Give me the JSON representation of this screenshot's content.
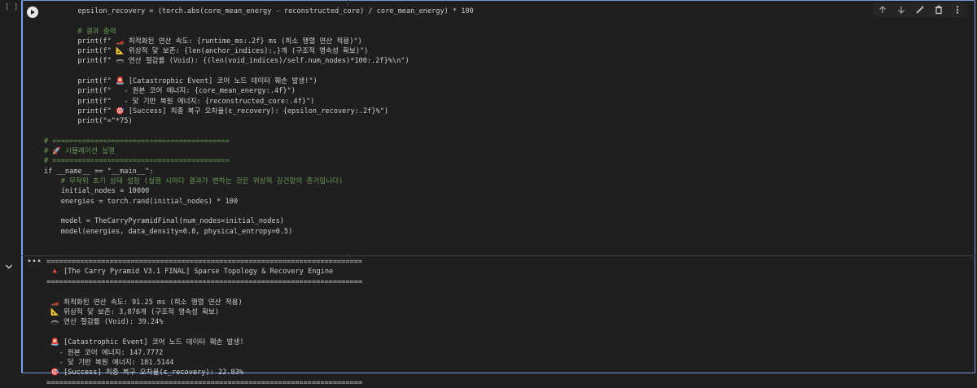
{
  "cell": {
    "exec_count": "[ ]"
  },
  "code_lines": [
    "        epsilon_recovery = (torch.abs(core_mean_energy - reconstructed_core) / core_mean_energy) * 100",
    "",
    "        # 결과 출력",
    "        print(f\" 🏎️ 최적화된 연산 속도: {runtime_ms:.2f} ms (희소 행렬 연산 적용)\")",
    "        print(f\" 📐 위상적 닻 보존: {len(anchor_indices):,}개 (구조적 영속성 확보)\")",
    "        print(f\" 🕳️ 연산 절감률 (Void): {(len(void_indices)/self.num_nodes)*100:.2f}%\\n\")",
    "",
    "        print(f\" 🚨 [Catastrophic Event] 코어 노드 데이터 훼손 발생!\")",
    "        print(f\"   - 원본 코어 에너지: {core_mean_energy:.4f}\")",
    "        print(f\"   - 닻 기반 복원 에너지: {reconstructed_core:.4f}\")",
    "        print(f\" 🎯 [Success] 최종 복구 오차율(ε_recovery): {epsilon_recovery:.2f}%\")",
    "        print(\"=\"*75)",
    "",
    "# ==========================================",
    "# 🚀 시뮬레이션 실행",
    "# ==========================================",
    "if __name__ == \"__main__\":",
    "    # 무작위 초기 상태 설정 (실행 시마다 결과가 변하는 것은 위상적 강건함의 증거입니다)",
    "    initial_nodes = 10000",
    "    energies = torch.rand(initial_nodes) * 100",
    "",
    "    model = TheCarryPyramidFinal(num_nodes=initial_nodes)",
    "    model(energies, data_density=0.8, physical_entropy=0.5)"
  ],
  "output_lines": [
    "===========================================================================",
    " 🔺 [The Carry Pyramid V3.1 FINAL] Sparse Topology & Recovery Engine",
    "===========================================================================",
    "",
    " 🏎️ 최적화된 연산 속도: 91.25 ms (희소 행렬 연산 적용)",
    " 📐 위상적 닻 보존: 3,876개 (구조적 영속성 확보)",
    " 🕳️ 연산 절감률 (Void): 39.24%",
    "",
    " 🚨 [Catastrophic Event] 코어 노드 데이터 훼손 발생!",
    "   - 원본 코어 에너지: 147.7772",
    "   - 닻 기반 복원 에너지: 181.5144",
    " 🎯 [Success] 최종 복구 오차율(ε_recovery): 22.83%",
    "==========================================================================="
  ],
  "toolbar": {
    "icons": [
      "move-up-icon",
      "move-down-icon",
      "edit-magic-icon",
      "delete-icon",
      "more-vert-icon"
    ]
  },
  "colors": {
    "background": "#1f1f1f",
    "focus_border": "#7aa2f7",
    "comment": "#6a9955",
    "string": "#ce9178",
    "keyword": "#c586c0"
  }
}
